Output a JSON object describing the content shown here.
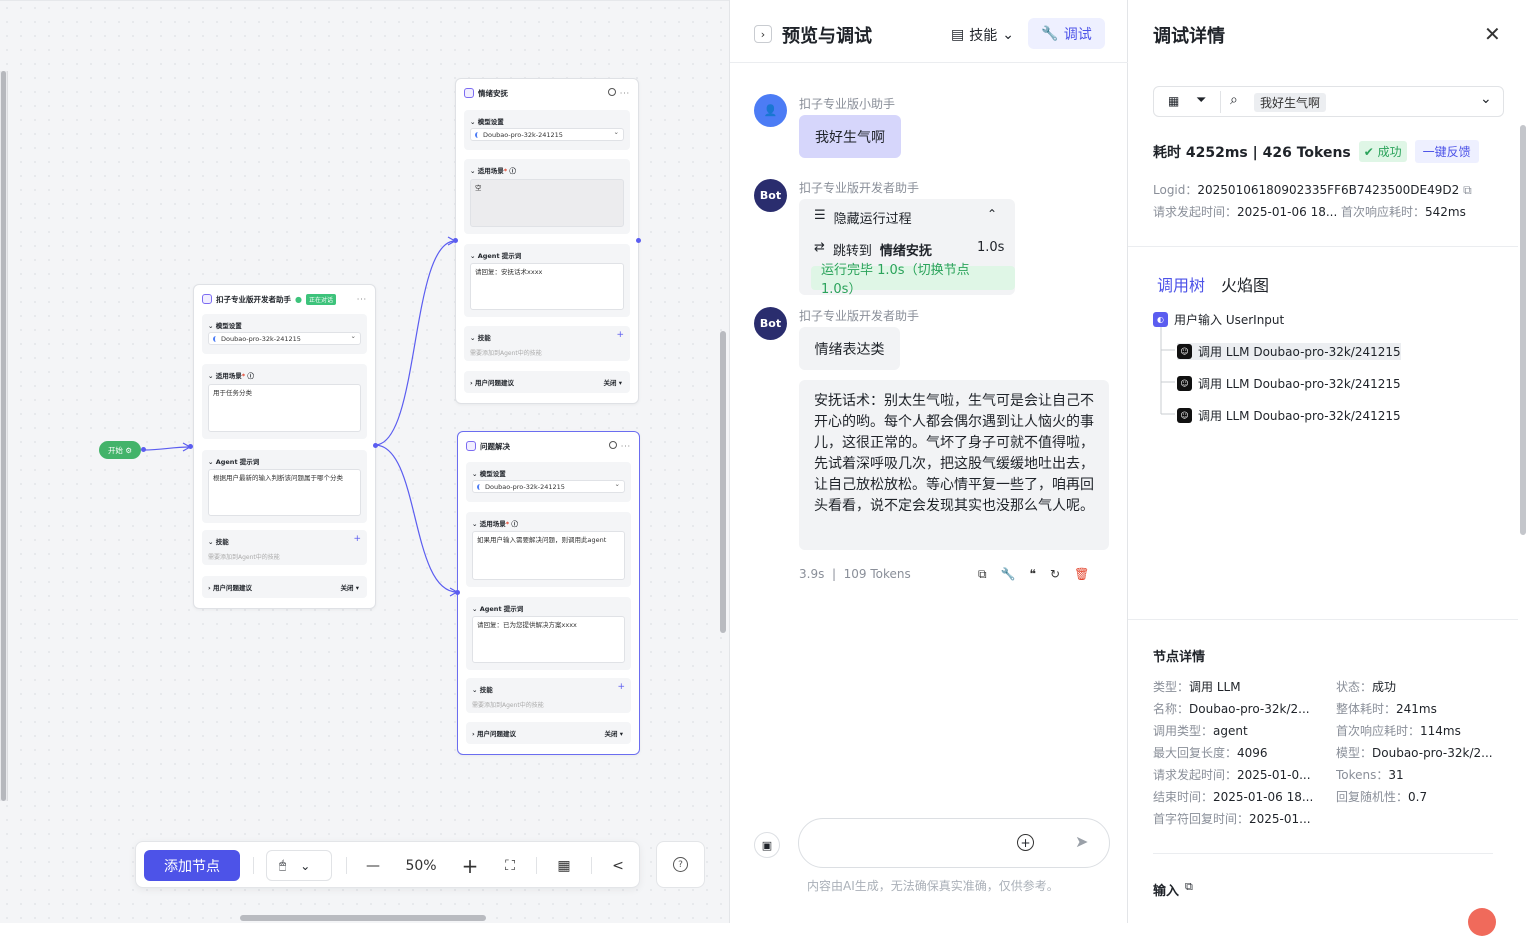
{
  "canvas": {
    "start_label": "开始",
    "main_node": {
      "title": "扣子专业版开发者助手",
      "badge": "正在对话",
      "model_label": "模型设置",
      "model": "Doubao-pro-32k-241215",
      "scene_label": "适用场景",
      "scene": "用于任务分类",
      "prompt_label": "Agent 提示词",
      "prompt": "根据用户最新的输入判断该问题属于哪个分类",
      "skill_label": "技能",
      "skill_hint": "需要添加到Agent中的技能",
      "suggest_label": "用户问题建议",
      "suggest_value": "关闭"
    },
    "node_a": {
      "title": "情绪安抚",
      "model_label": "模型设置",
      "model": "Doubao-pro-32k-241215",
      "scene_label": "适用场景",
      "scene": "空",
      "prompt_label": "Agent 提示词",
      "prompt": "请回复：安抚话术xxxx",
      "skill_label": "技能",
      "skill_hint": "需要添加到Agent中的技能",
      "suggest_label": "用户问题建议",
      "suggest_value": "关闭"
    },
    "node_b": {
      "title": "问题解决",
      "model_label": "模型设置",
      "model": "Doubao-pro-32k-241215",
      "scene_label": "适用场景",
      "scene": "如果用户输入需要解决问题，则调用此agent",
      "prompt_label": "Agent 提示词",
      "prompt": "请回复：已为您提供解决方案xxxx",
      "skill_label": "技能",
      "skill_hint": "需要添加到Agent中的技能",
      "suggest_label": "用户问题建议",
      "suggest_value": "关闭"
    },
    "toolbar": {
      "add_node": "添加节点",
      "zoom": "50%"
    }
  },
  "preview": {
    "title": "预览与调试",
    "skill_label": "技能",
    "debug_label": "调试",
    "user_name": "扣子专业版小助手",
    "user_msg": "我好生气啊",
    "bot_label": "Bot",
    "bot_name": "扣子专业版开发者助手",
    "run_toggle": "隐藏运行过程",
    "jump_text": "跳转到",
    "jump_target": "情绪安抚",
    "jump_time": "1.0s",
    "run_done": "运行完毕 1.0s（切换节点 1.0s）",
    "category": "情绪表达类",
    "reply": "安抚话术：别太生气啦，生气可是会让自己不开心的哟。每个人都会偶尔遇到让人恼火的事儿，这很正常的。气坏了身子可就不值得啦，先试着深呼吸几次，把这股气缓缓地吐出去，让自己放松放松。等心情平复一些了，咱再回头看看，说不定会发现其实也没那么气人呢。",
    "time": "3.9s",
    "tokens": "109 Tokens",
    "disclaimer": "内容由AI生成，无法确保真实准确，仅供参考。"
  },
  "details": {
    "title": "调试详情",
    "search_tag": "我好生气啊",
    "summary": "耗时 4252ms | 426 Tokens",
    "status": "成功",
    "feedback": "一键反馈",
    "logid_label": "Logid：",
    "logid": "20250106180902335FF6B7423500DE49D2",
    "req_label": "请求发起时间：",
    "req_time": "2025-01-06 18...",
    "first_label": "首次响应耗时：",
    "first_time": "542ms",
    "tab_tree": "调用树",
    "tab_flame": "火焰图",
    "tree_root": "用户输入 UserInput",
    "tree_children": [
      "调用 LLM Doubao-pro-32k/241215",
      "调用 LLM Doubao-pro-32k/241215",
      "调用 LLM Doubao-pro-32k/241215"
    ],
    "node_title": "节点详情",
    "left": [
      {
        "k": "类型：",
        "v": "调用 LLM"
      },
      {
        "k": "名称：",
        "v": "Doubao-pro-32k/2..."
      },
      {
        "k": "调用类型：",
        "v": "agent"
      },
      {
        "k": "最大回复长度：",
        "v": "4096"
      },
      {
        "k": "请求发起时间：",
        "v": "2025-01-0..."
      },
      {
        "k": "结束时间：",
        "v": "2025-01-06 18..."
      },
      {
        "k": "首字符回复时间：",
        "v": "2025-01..."
      }
    ],
    "right": [
      {
        "k": "状态：",
        "v": "成功"
      },
      {
        "k": "整体耗时：",
        "v": "241ms"
      },
      {
        "k": "首次响应耗时：",
        "v": "114ms"
      },
      {
        "k": "模型：",
        "v": "Doubao-pro-32k/2..."
      },
      {
        "k": "Tokens：",
        "v": "31"
      },
      {
        "k": "回复随机性：",
        "v": "0.7"
      }
    ],
    "input_label": "输入"
  }
}
